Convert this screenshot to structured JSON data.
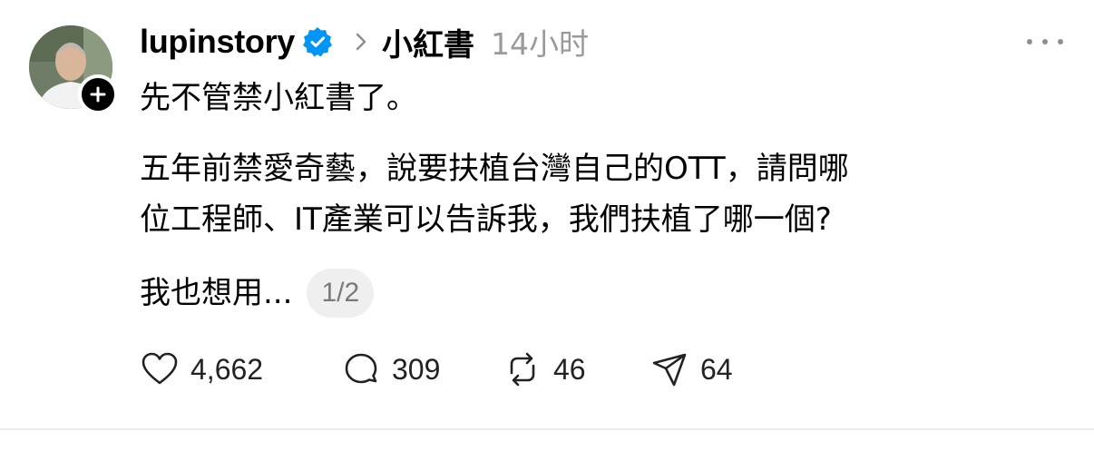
{
  "post": {
    "username": "lupinstory",
    "community": "小紅書",
    "time": "14小时",
    "lines": [
      "先不管禁小紅書了。",
      "五年前禁愛奇藝，說要扶植台灣自己的OTT，請問哪",
      "位工程師、IT產業可以告訴我，我們扶植了哪一個?",
      "我也想用..."
    ],
    "page_indicator": "1/2"
  },
  "actions": {
    "likes": "4,662",
    "replies": "309",
    "reposts": "46",
    "shares": "64"
  },
  "icons": {
    "verified": "verified-badge-icon",
    "follow": "plus-icon",
    "more": "more-icon",
    "like": "heart-icon",
    "reply": "comment-icon",
    "repost": "repost-icon",
    "share": "send-icon"
  },
  "colors": {
    "verified": "#0095f6",
    "muted": "#9a9a9a",
    "pill_bg": "#efefef"
  }
}
